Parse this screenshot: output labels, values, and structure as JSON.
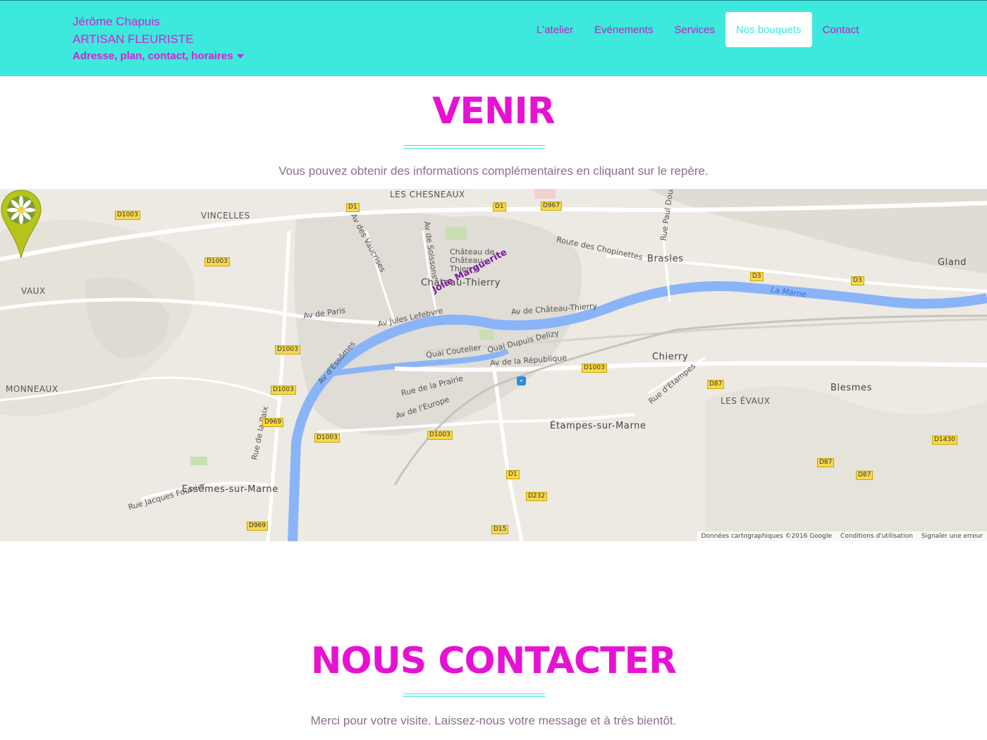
{
  "header": {
    "brand_name": "Jérôme Chapuis",
    "brand_sub": "ARTISAN FLEURISTE",
    "brand_dropdown": "Adresse, plan, contact, horaires",
    "nav": [
      {
        "label": "L'atelier",
        "active": false
      },
      {
        "label": "Evénements",
        "active": false
      },
      {
        "label": "Services",
        "active": false
      },
      {
        "label": "Nos bouquets",
        "active": true
      },
      {
        "label": "Contact",
        "active": false
      }
    ]
  },
  "venir": {
    "title": "VENIR",
    "text": "Vous pouvez obtenir des informations complémentaires en cliquant sur le repère."
  },
  "map": {
    "places": {
      "vincelles": "VINCELLES",
      "chesneaux": "LES CHESNEAUX",
      "vaux": "VAUX",
      "monneaux": "MONNEAUX",
      "chateau": "Château de Château-Thierry",
      "chateau_thierry": "Château-Thierry",
      "brasles": "Brasles",
      "gland": "Gland",
      "chierry": "Chierry",
      "blesmes": "Blesmes",
      "evaux": "LES ÉVAUX",
      "etampes": "Étampes-sur-Marne",
      "essomes": "Essômes-sur-Marne",
      "la_marne": "La Marne"
    },
    "roads": {
      "av_paris": "Av de Paris",
      "av_jules": "Av Jules Lefebvre",
      "av_chateau": "Av de Château-Thierry",
      "route_chopinettes": "Route des Chopinettes",
      "av_essomes": "Av d'Essômes",
      "quai_coutelier": "Quai Coutelier",
      "quai_dupuis": "Quai Dupuis Delizy",
      "av_republique": "Av de la République",
      "rue_prairie": "Rue de la Prairie",
      "av_europe": "Av de l'Europe",
      "rue_paix": "Rue de la Paix",
      "rue_fourrier": "Rue Jacques Fourrier",
      "av_vaucrises": "Av des Vaucrises",
      "av_soissons": "Av de Soissons",
      "rue_etampes": "Rue d'Etampes",
      "rue_paul": "Rue Paul Doumer"
    },
    "badges": [
      "D1003",
      "D1003",
      "D1003",
      "D1003",
      "D1003",
      "D1003",
      "D1003",
      "D1",
      "D1",
      "D967",
      "D3",
      "D3",
      "D969",
      "D969",
      "D87",
      "D87",
      "D87",
      "D1430",
      "D232",
      "D15",
      "D1"
    ],
    "marker_label": "Jolie Marguerite",
    "footer": [
      "Données cartographiques ©2016 Google",
      "Conditions d'utilisation",
      "Signaler une erreur"
    ]
  },
  "contact": {
    "title": "NOUS CONTACTER",
    "text": "Merci pour votre visite. Laissez-nous votre message et à très bientôt."
  },
  "colors": {
    "header_bg": "#3de8dc",
    "accent": "#e612d2",
    "nav_text": "#c21fc2",
    "body_text": "#8c6d8c",
    "river": "#8ab4f8"
  }
}
